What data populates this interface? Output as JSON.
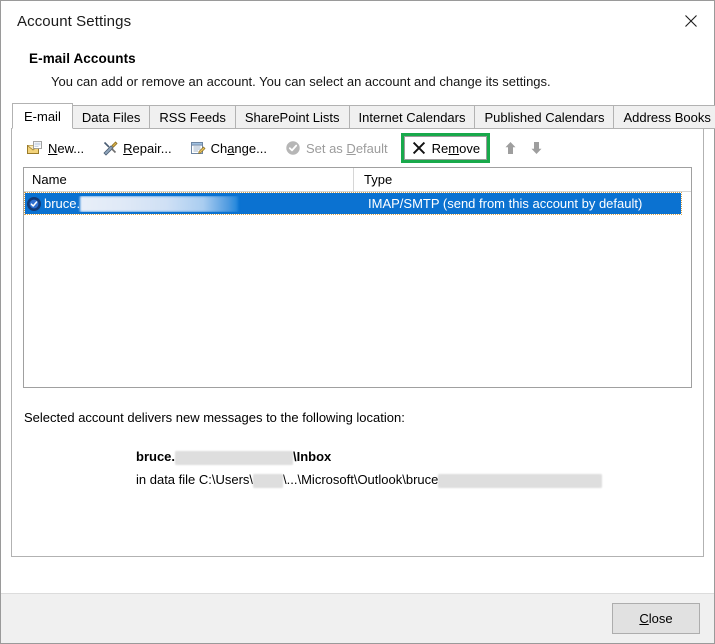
{
  "window": {
    "title": "Account Settings",
    "close_icon": "close-icon"
  },
  "header": {
    "title": "E-mail Accounts",
    "description": "You can add or remove an account. You can select an account and change its settings."
  },
  "tabs": [
    {
      "label": "E-mail",
      "selected": true
    },
    {
      "label": "Data Files",
      "selected": false
    },
    {
      "label": "RSS Feeds",
      "selected": false
    },
    {
      "label": "SharePoint Lists",
      "selected": false
    },
    {
      "label": "Internet Calendars",
      "selected": false
    },
    {
      "label": "Published Calendars",
      "selected": false
    },
    {
      "label": "Address Books",
      "selected": false
    }
  ],
  "toolbar": {
    "new": {
      "label": "New...",
      "accel": "N",
      "icon": "new-mail-icon",
      "enabled": true
    },
    "repair": {
      "label": "Repair...",
      "accel": "R",
      "icon": "repair-tools-icon",
      "enabled": true
    },
    "change": {
      "label": "Change...",
      "accel": "a",
      "icon": "change-document-icon",
      "enabled": true
    },
    "set_default": {
      "label": "Set as Default",
      "accel": "D",
      "icon": "check-circle-icon",
      "enabled": false
    },
    "remove": {
      "label": "Remove",
      "accel": "m",
      "icon": "x-icon",
      "enabled": true,
      "highlighted": true,
      "highlight_color": "#18a94b"
    },
    "move_up": {
      "icon": "arrow-up-icon",
      "enabled": false
    },
    "move_down": {
      "icon": "arrow-down-icon",
      "enabled": false
    }
  },
  "account_list": {
    "columns": [
      "Name",
      "Type"
    ],
    "rows": [
      {
        "icon": "account-badge-icon",
        "name_prefix": "bruce.",
        "name_redacted": true,
        "type": "IMAP/SMTP (send from this account by default)",
        "selected": true
      }
    ]
  },
  "detail": {
    "intro": "Selected account delivers new messages to the following location:",
    "location_prefix": "bruce.",
    "location_suffix": "\\Inbox",
    "datafile_prefix": "in data file C:\\Users\\",
    "datafile_middle": "\\...\\Microsoft\\Outlook\\bruce"
  },
  "footer": {
    "close_label": "Close",
    "close_accel": "C"
  },
  "colors": {
    "selection_blue": "#0b72d1",
    "highlight_green": "#18a94b",
    "dialog_gray": "#f0f0f0",
    "border_gray": "#b2b2b2"
  }
}
